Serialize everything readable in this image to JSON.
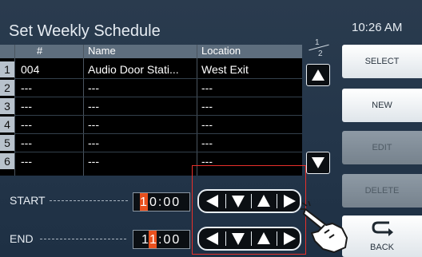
{
  "header": {
    "title": "Set Weekly Schedule",
    "clock": "10:26 AM"
  },
  "table": {
    "columns": [
      "#",
      "Name",
      "Location"
    ],
    "rows": [
      {
        "num": "1",
        "id": "004",
        "name": "Audio Door Stati...",
        "location": "West Exit"
      },
      {
        "num": "2",
        "id": "---",
        "name": "---",
        "location": "---"
      },
      {
        "num": "3",
        "id": "---",
        "name": "---",
        "location": "---"
      },
      {
        "num": "4",
        "id": "---",
        "name": "---",
        "location": "---"
      },
      {
        "num": "5",
        "id": "---",
        "name": "---",
        "location": "---"
      },
      {
        "num": "6",
        "id": "---",
        "name": "---",
        "location": "---"
      }
    ]
  },
  "pager": {
    "current": "1",
    "total": "2"
  },
  "sidebar": {
    "select_label": "SELECT",
    "new_label": "NEW",
    "edit_label": "EDIT",
    "delete_label": "DELETE",
    "back_label": "BACK"
  },
  "schedule": {
    "start_label": "START",
    "end_label": "END",
    "start": {
      "hour_first": "1",
      "rest": "0:00"
    },
    "end": {
      "hour_first": "1",
      "hour_second": "1",
      "rest": ":00"
    }
  },
  "icons": {
    "scroll_up": "triangle-up-icon",
    "scroll_down": "triangle-down-icon",
    "left": "triangle-left-icon",
    "down": "triangle-down-icon",
    "up": "triangle-up-icon",
    "right": "triangle-right-icon",
    "back": "back-arrow-icon",
    "hand": "pointing-hand-icon"
  },
  "colors": {
    "highlight": "#e8501e",
    "callout": "#e8302a"
  }
}
